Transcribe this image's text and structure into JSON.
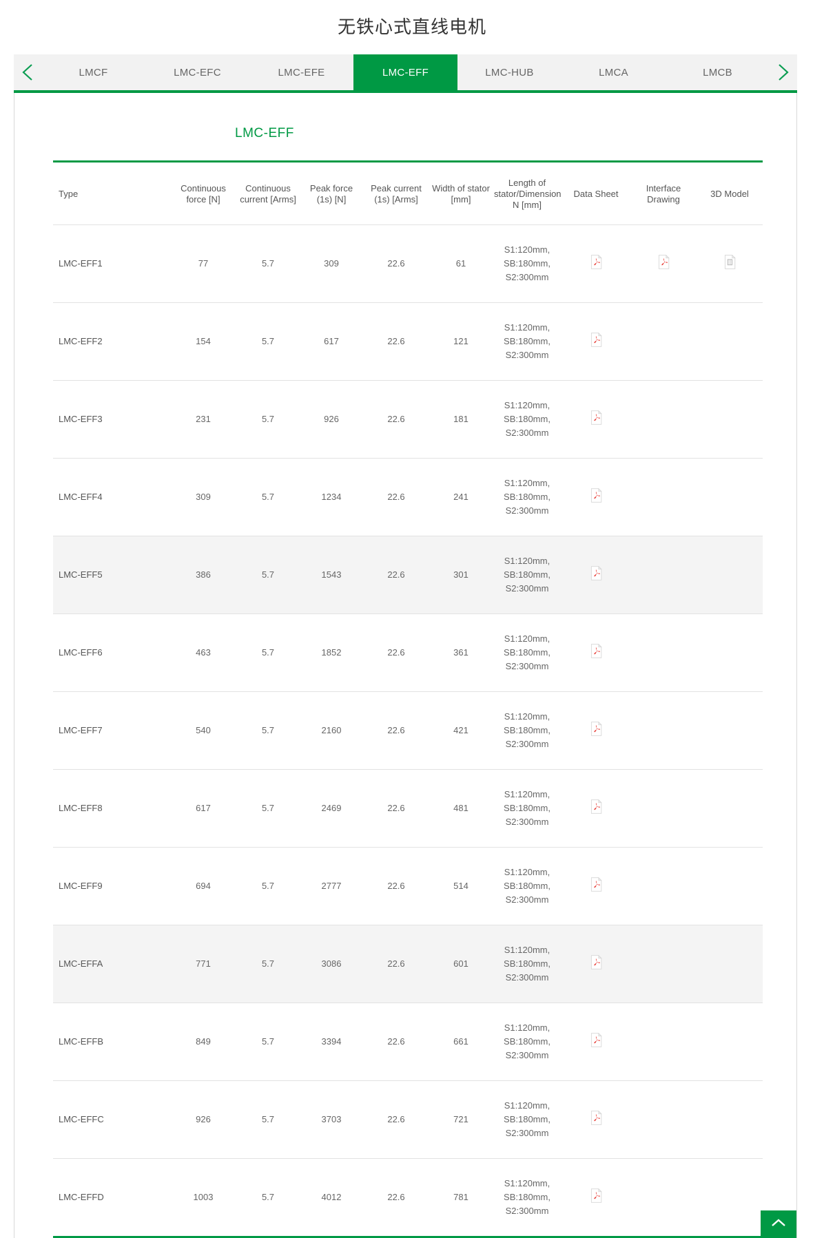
{
  "header": {
    "title": "无铁心式直线电机"
  },
  "tabs": {
    "prev_icon": "chevron-left-icon",
    "next_icon": "chevron-right-icon",
    "items": [
      {
        "label": "LMCF",
        "active": false
      },
      {
        "label": "LMC-EFC",
        "active": false
      },
      {
        "label": "LMC-EFE",
        "active": false
      },
      {
        "label": "LMC-EFF",
        "active": true
      },
      {
        "label": "LMC-HUB",
        "active": false
      },
      {
        "label": "LMCA",
        "active": false
      },
      {
        "label": "LMCB",
        "active": false
      }
    ]
  },
  "section": {
    "title": "LMC-EFF"
  },
  "table": {
    "columns": [
      "Type",
      "Continuous force [N]",
      "Continuous current [Arms]",
      "Peak force (1s) [N]",
      "Peak current (1s) [Arms]",
      "Width of stator [mm]",
      "Length of stator/Dimension N [mm]",
      "Data Sheet",
      "Interface Drawing",
      "3D Model"
    ],
    "rows": [
      {
        "type": "LMC-EFF1",
        "cont_force": "77",
        "cont_current": "5.7",
        "peak_force": "309",
        "peak_current": "22.6",
        "width": "61",
        "length": "S1:120mm,\nSB:180mm,\nS2:300mm",
        "data_sheet": "pdf-icon",
        "interface_drawing": "pdf-icon",
        "model_3d": "3d-model-icon",
        "highlight": false
      },
      {
        "type": "LMC-EFF2",
        "cont_force": "154",
        "cont_current": "5.7",
        "peak_force": "617",
        "peak_current": "22.6",
        "width": "121",
        "length": "S1:120mm,\nSB:180mm,\nS2:300mm",
        "data_sheet": "pdf-icon",
        "interface_drawing": "",
        "model_3d": "",
        "highlight": false
      },
      {
        "type": "LMC-EFF3",
        "cont_force": "231",
        "cont_current": "5.7",
        "peak_force": "926",
        "peak_current": "22.6",
        "width": "181",
        "length": "S1:120mm,\nSB:180mm,\nS2:300mm",
        "data_sheet": "pdf-icon",
        "interface_drawing": "",
        "model_3d": "",
        "highlight": false
      },
      {
        "type": "LMC-EFF4",
        "cont_force": "309",
        "cont_current": "5.7",
        "peak_force": "1234",
        "peak_current": "22.6",
        "width": "241",
        "length": "S1:120mm,\nSB:180mm,\nS2:300mm",
        "data_sheet": "pdf-icon",
        "interface_drawing": "",
        "model_3d": "",
        "highlight": false
      },
      {
        "type": "LMC-EFF5",
        "cont_force": "386",
        "cont_current": "5.7",
        "peak_force": "1543",
        "peak_current": "22.6",
        "width": "301",
        "length": "S1:120mm,\nSB:180mm,\nS2:300mm",
        "data_sheet": "pdf-icon",
        "interface_drawing": "",
        "model_3d": "",
        "highlight": true
      },
      {
        "type": "LMC-EFF6",
        "cont_force": "463",
        "cont_current": "5.7",
        "peak_force": "1852",
        "peak_current": "22.6",
        "width": "361",
        "length": "S1:120mm,\nSB:180mm,\nS2:300mm",
        "data_sheet": "pdf-icon",
        "interface_drawing": "",
        "model_3d": "",
        "highlight": false
      },
      {
        "type": "LMC-EFF7",
        "cont_force": "540",
        "cont_current": "5.7",
        "peak_force": "2160",
        "peak_current": "22.6",
        "width": "421",
        "length": "S1:120mm,\nSB:180mm,\nS2:300mm",
        "data_sheet": "pdf-icon",
        "interface_drawing": "",
        "model_3d": "",
        "highlight": false
      },
      {
        "type": "LMC-EFF8",
        "cont_force": "617",
        "cont_current": "5.7",
        "peak_force": "2469",
        "peak_current": "22.6",
        "width": "481",
        "length": "S1:120mm,\nSB:180mm,\nS2:300mm",
        "data_sheet": "pdf-icon",
        "interface_drawing": "",
        "model_3d": "",
        "highlight": false
      },
      {
        "type": "LMC-EFF9",
        "cont_force": "694",
        "cont_current": "5.7",
        "peak_force": "2777",
        "peak_current": "22.6",
        "width": "514",
        "length": "S1:120mm,\nSB:180mm,\nS2:300mm",
        "data_sheet": "pdf-icon",
        "interface_drawing": "",
        "model_3d": "",
        "highlight": false
      },
      {
        "type": "LMC-EFFA",
        "cont_force": "771",
        "cont_current": "5.7",
        "peak_force": "3086",
        "peak_current": "22.6",
        "width": "601",
        "length": "S1:120mm,\nSB:180mm,\nS2:300mm",
        "data_sheet": "pdf-icon",
        "interface_drawing": "",
        "model_3d": "",
        "highlight": true
      },
      {
        "type": "LMC-EFFB",
        "cont_force": "849",
        "cont_current": "5.7",
        "peak_force": "3394",
        "peak_current": "22.6",
        "width": "661",
        "length": "S1:120mm,\nSB:180mm,\nS2:300mm",
        "data_sheet": "pdf-icon",
        "interface_drawing": "",
        "model_3d": "",
        "highlight": false
      },
      {
        "type": "LMC-EFFC",
        "cont_force": "926",
        "cont_current": "5.7",
        "peak_force": "3703",
        "peak_current": "22.6",
        "width": "721",
        "length": "S1:120mm,\nSB:180mm,\nS2:300mm",
        "data_sheet": "pdf-icon",
        "interface_drawing": "",
        "model_3d": "",
        "highlight": false
      },
      {
        "type": "LMC-EFFD",
        "cont_force": "1003",
        "cont_current": "5.7",
        "peak_force": "4012",
        "peak_current": "22.6",
        "width": "781",
        "length": "S1:120mm,\nSB:180mm,\nS2:300mm",
        "data_sheet": "pdf-icon",
        "interface_drawing": "",
        "model_3d": "",
        "highlight": false
      }
    ]
  },
  "scroll_top": {
    "icon": "chevron-up-icon"
  },
  "colors": {
    "brand_green": "#009944",
    "tab_bar_bg": "#f2f2f2",
    "row_highlight": "#f4f4f4",
    "pdf_red": "#e8403a"
  }
}
